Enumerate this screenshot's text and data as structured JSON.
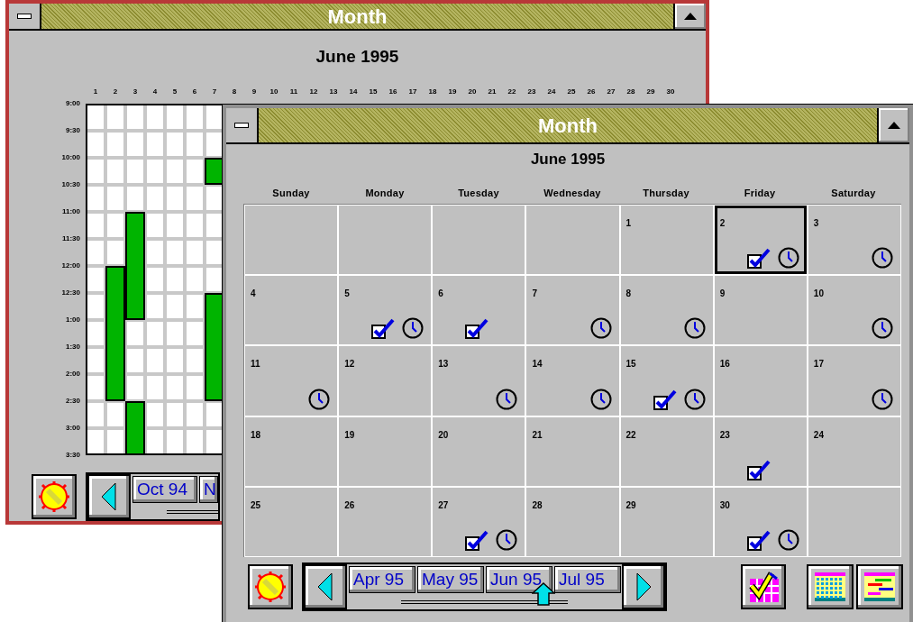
{
  "back_window": {
    "title": "Month",
    "heading": "June 1995",
    "day_labels": [
      "1",
      "2",
      "3",
      "4",
      "5",
      "6",
      "7",
      "8",
      "9",
      "10",
      "11",
      "12",
      "13",
      "14",
      "15",
      "16",
      "17",
      "18",
      "19",
      "20",
      "21",
      "22",
      "23",
      "24",
      "25",
      "26",
      "27",
      "28",
      "29",
      "30"
    ],
    "time_labels": [
      "9:00",
      "9:30",
      "10:00",
      "10:30",
      "11:00",
      "11:30",
      "12:00",
      "12:30",
      "1:00",
      "1:30",
      "2:00",
      "2:30",
      "3:00",
      "3:30"
    ],
    "schedule": [
      {
        "booked": [
          false,
          false,
          false,
          false,
          false,
          false,
          false,
          false,
          false,
          false,
          false,
          false,
          false
        ]
      },
      {
        "booked": [
          false,
          false,
          false,
          false,
          false,
          false,
          true,
          true,
          true,
          true,
          true,
          false,
          false
        ]
      },
      {
        "booked": [
          false,
          false,
          false,
          false,
          true,
          true,
          true,
          true,
          false,
          false,
          false,
          true,
          true
        ]
      },
      {
        "booked": [
          false,
          false,
          false,
          false,
          false,
          false,
          false,
          false,
          false,
          false,
          false,
          false,
          false
        ]
      },
      {
        "booked": [
          false,
          false,
          false,
          false,
          false,
          false,
          false,
          false,
          false,
          false,
          false,
          false,
          false
        ]
      },
      {
        "booked": [
          false,
          false,
          false,
          false,
          false,
          false,
          false,
          false,
          false,
          false,
          false,
          false,
          false
        ]
      },
      {
        "booked": [
          false,
          false,
          true,
          false,
          false,
          false,
          false,
          true,
          true,
          true,
          true,
          false,
          false
        ]
      }
    ],
    "months": [
      "Oct 94",
      "N"
    ]
  },
  "front_window": {
    "title": "Month",
    "heading": "June 1995",
    "weekdays": [
      "Sunday",
      "Monday",
      "Tuesday",
      "Wednesday",
      "Thursday",
      "Friday",
      "Saturday"
    ],
    "weeks": [
      [
        {
          "selected": false,
          "task": false,
          "appointment": false
        },
        {
          "selected": false,
          "task": false,
          "appointment": false
        },
        {
          "selected": false,
          "task": false,
          "appointment": false
        },
        {
          "selected": false,
          "task": false,
          "appointment": false
        },
        {
          "date": "1",
          "selected": false,
          "task": false,
          "appointment": false
        },
        {
          "date": "2",
          "selected": true,
          "task": true,
          "appointment": true
        },
        {
          "date": "3",
          "selected": false,
          "task": false,
          "appointment": true
        }
      ],
      [
        {
          "date": "4",
          "selected": false,
          "task": false,
          "appointment": false
        },
        {
          "date": "5",
          "selected": false,
          "task": true,
          "appointment": true
        },
        {
          "date": "6",
          "selected": false,
          "task": true,
          "appointment": false
        },
        {
          "date": "7",
          "selected": false,
          "task": false,
          "appointment": true
        },
        {
          "date": "8",
          "selected": false,
          "task": false,
          "appointment": true
        },
        {
          "date": "9",
          "selected": false,
          "task": false,
          "appointment": false
        },
        {
          "date": "10",
          "selected": false,
          "task": false,
          "appointment": true
        }
      ],
      [
        {
          "date": "11",
          "selected": false,
          "task": false,
          "appointment": true
        },
        {
          "date": "12",
          "selected": false,
          "task": false,
          "appointment": false
        },
        {
          "date": "13",
          "selected": false,
          "task": false,
          "appointment": true
        },
        {
          "date": "14",
          "selected": false,
          "task": false,
          "appointment": true
        },
        {
          "date": "15",
          "selected": false,
          "task": true,
          "appointment": true
        },
        {
          "date": "16",
          "selected": false,
          "task": false,
          "appointment": false
        },
        {
          "date": "17",
          "selected": false,
          "task": false,
          "appointment": true
        }
      ],
      [
        {
          "date": "18",
          "selected": false,
          "task": false,
          "appointment": false
        },
        {
          "date": "19",
          "selected": false,
          "task": false,
          "appointment": false
        },
        {
          "date": "20",
          "selected": false,
          "task": false,
          "appointment": false
        },
        {
          "date": "21",
          "selected": false,
          "task": false,
          "appointment": false
        },
        {
          "date": "22",
          "selected": false,
          "task": false,
          "appointment": false
        },
        {
          "date": "23",
          "selected": false,
          "task": true,
          "appointment": false
        },
        {
          "date": "24",
          "selected": false,
          "task": false,
          "appointment": false
        }
      ],
      [
        {
          "date": "25",
          "selected": false,
          "task": false,
          "appointment": false
        },
        {
          "date": "26",
          "selected": false,
          "task": false,
          "appointment": false
        },
        {
          "date": "27",
          "selected": false,
          "task": true,
          "appointment": true
        },
        {
          "date": "28",
          "selected": false,
          "task": false,
          "appointment": false
        },
        {
          "date": "29",
          "selected": false,
          "task": false,
          "appointment": false
        },
        {
          "date": "30",
          "selected": false,
          "task": true,
          "appointment": true
        },
        {
          "selected": false,
          "task": false,
          "appointment": false
        }
      ]
    ],
    "months": [
      "Apr 95",
      "May 95",
      "Jun 95",
      "Jul 95"
    ]
  }
}
